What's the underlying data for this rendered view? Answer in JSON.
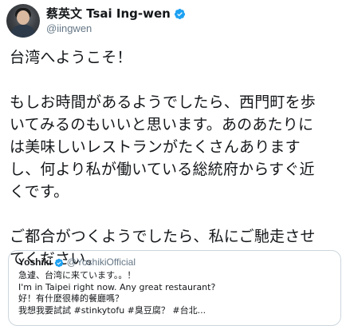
{
  "header": {
    "display_name": "蔡英文 Tsai Ing-wen",
    "handle": "@iingwen",
    "verified": true
  },
  "tweet": {
    "lines": [
      "台湾へようこそ！",
      "",
      "もしお時間があるようでしたら、西門町を歩",
      "いてみるのもいいと思います。あのあたりに",
      "は美味しいレストランがたくさんあります",
      "し、何より私が働いている総統府からすぐ近",
      "くです。",
      "",
      "ご都合がつくようでしたら、私にご馳走させ",
      "てください。"
    ]
  },
  "quoted_tweet": {
    "display_name": "Yoshiki",
    "handle": "@YoshikiOfficial",
    "verified": true,
    "lines": [
      "急遽、台湾に来ています。。！",
      "I'm in Taipei right now. Any great restaurant?",
      "好！有什麼很棒的餐廳嗎？",
      "我想我要試試 #stinkytofu #臭豆腐？ #台北..."
    ]
  },
  "colors": {
    "verified_badge": "#1da1f2",
    "secondary_text": "#657786",
    "border": "#ccd6dd"
  },
  "icons": {
    "verified": "verified-badge-icon"
  }
}
